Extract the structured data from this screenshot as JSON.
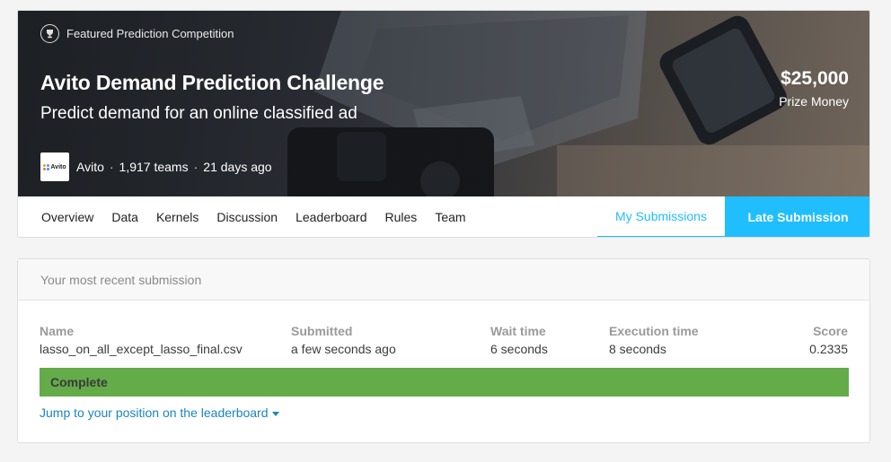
{
  "competition": {
    "tag": "Featured Prediction Competition",
    "title": "Avito Demand Prediction Challenge",
    "subtitle": "Predict demand for an online classified ad",
    "org_logo_text": "Avito",
    "org_name": "Avito",
    "teams": "1,917 teams",
    "age": "21 days ago",
    "prize_amount": "$25,000",
    "prize_label": "Prize Money",
    "logo_dot_colors": [
      "#97cf26",
      "#a169f7",
      "#ff6163",
      "#00aaff"
    ]
  },
  "nav": {
    "tabs": [
      "Overview",
      "Data",
      "Kernels",
      "Discussion",
      "Leaderboard",
      "Rules",
      "Team"
    ],
    "my_submissions": "My Submissions",
    "late_submission": "Late Submission",
    "accent": "#20beff"
  },
  "submission": {
    "header": "Your most recent submission",
    "columns": {
      "name": {
        "label": "Name",
        "value": "lasso_on_all_except_lasso_final.csv"
      },
      "submitted": {
        "label": "Submitted",
        "value": "a few seconds ago"
      },
      "wait": {
        "label": "Wait time",
        "value": "6 seconds"
      },
      "execution": {
        "label": "Execution time",
        "value": "8 seconds"
      },
      "score": {
        "label": "Score",
        "value": "0.2335"
      }
    },
    "status": "Complete",
    "status_color": "#64ab4a",
    "jump_link": "Jump to your position on the leaderboard"
  },
  "icons": {
    "tag_icon": "trophy-icon",
    "link_icon": "caret-down-icon"
  }
}
